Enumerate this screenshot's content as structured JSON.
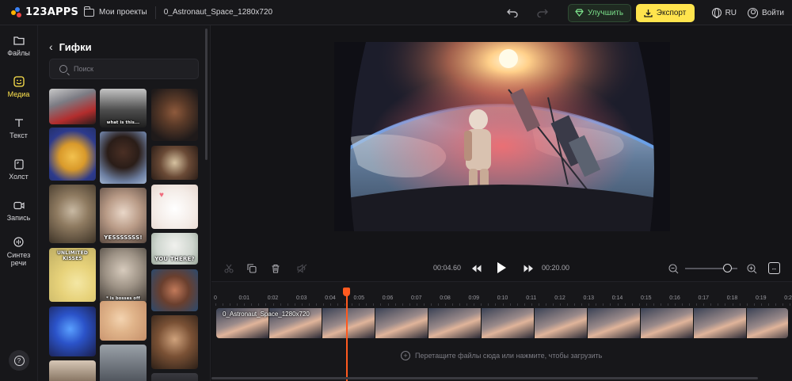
{
  "app": {
    "logo_text": "123APPS"
  },
  "header": {
    "projects_label": "Мои проекты",
    "file_name": "0_Astronaut_Space_1280x720",
    "upgrade_label": "Улучшить",
    "export_label": "Экспорт",
    "language": "RU",
    "login_label": "Войти",
    "colors": {
      "upgrade_text": "#7be08a",
      "export_bg": "#ffe44d"
    }
  },
  "sidebar": {
    "items": [
      {
        "label": "Файлы",
        "icon": "folder-icon",
        "active": false
      },
      {
        "label": "Медиа",
        "icon": "media-icon",
        "active": true
      },
      {
        "label": "Текст",
        "icon": "text-icon",
        "active": false
      },
      {
        "label": "Холст",
        "icon": "canvas-icon",
        "active": false
      },
      {
        "label": "Запись",
        "icon": "record-icon",
        "active": false
      },
      {
        "label": "Синтез речи",
        "icon": "speech-icon",
        "active": false
      }
    ],
    "help_icon": "help-icon"
  },
  "panel": {
    "title": "Гифки",
    "search_placeholder": "Поиск",
    "gif_captions": {
      "g2": "what is this...",
      "g8": "YESSSSSSS!",
      "g10": "UNLIMITED KISSES",
      "g11": "YOU THERE?",
      "g13": "* is bosses off"
    }
  },
  "player": {
    "current_time": "00:04.60",
    "total_time": "00:20.00",
    "zoom_level": 0.8
  },
  "timeline": {
    "ruler_labels": [
      "0",
      "0:01",
      "0:02",
      "0:03",
      "0:04",
      "0:05",
      "0:06",
      "0:07",
      "0:08",
      "0:09",
      "0:10",
      "0:11",
      "0:12",
      "0:13",
      "0:14",
      "0:15",
      "0:16",
      "0:17",
      "0:18",
      "0:19",
      "0:20"
    ],
    "clip_name": "0_Astronaut_Space_1280x720",
    "drop_hint": "Перетащите файлы сюда или нажмите, чтобы загрузить"
  }
}
